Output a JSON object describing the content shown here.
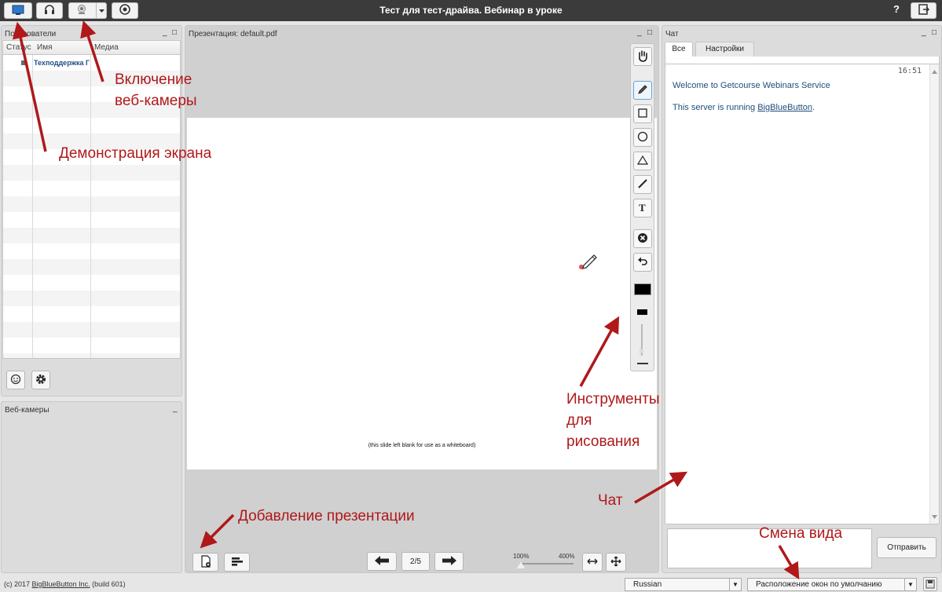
{
  "window": {
    "title": "Тест для тест-драйва. Вебинар в уроке",
    "help": "?"
  },
  "users_panel": {
    "title": "Пользователи",
    "columns": [
      "Статус",
      "Имя",
      "Медиа"
    ],
    "rows": [
      {
        "name": "Техподдержка Г"
      }
    ],
    "minimize": "_",
    "maximize": "□"
  },
  "webcams_panel": {
    "title": "Веб-камеры",
    "minimize": "_",
    "maximize": "□"
  },
  "presentation": {
    "title": "Презентация: default.pdf",
    "slide_caption": "(this slide left blank for use as a whiteboard)",
    "page_indicator": "2/5",
    "zoom_min": "100%",
    "zoom_max": "400%",
    "minimize": "_",
    "maximize": "□"
  },
  "chat": {
    "title": "Чат",
    "tabs": [
      "Все",
      "Настройки"
    ],
    "timestamp": "16:51",
    "welcome": "Welcome to Getcourse Webinars Service",
    "running_prefix": "This server is running ",
    "running_link": "BigBlueButton",
    "running_suffix": ".",
    "send_label": "Отправить",
    "minimize": "_",
    "maximize": "□"
  },
  "annotations": {
    "webcam": [
      "Включение",
      "веб-камеры"
    ],
    "screen": "Демонстрация экрана",
    "tools": [
      "Инструменты",
      "для",
      "рисования"
    ],
    "add_presentation": "Добавление презентации",
    "chat": "Чат",
    "layout": "Смена вида"
  },
  "footer": {
    "copyright_prefix": "(c) 2017 ",
    "copyright_link": "BigBlueButton Inc.",
    "build": " (build 601)",
    "language": "Russian",
    "layout": "Расположение окон по умолчанию"
  },
  "colors": {
    "annotation": "#b0181a",
    "topbar": "#3b3b3b",
    "link": "#1f4e79",
    "accent": "#3b7dd8"
  },
  "icons": [
    "screen-share-icon",
    "headset-icon",
    "webcam-icon",
    "record-icon",
    "logout-icon",
    "emoji-icon",
    "gear-icon",
    "hand-icon",
    "pencil-icon",
    "rectangle-icon",
    "ellipse-icon",
    "triangle-icon",
    "line-icon",
    "text-icon",
    "clear-icon",
    "undo-icon",
    "upload-icon",
    "poll-icon",
    "arrow-left-icon",
    "arrow-right-icon",
    "fit-width-icon",
    "fit-page-icon"
  ]
}
